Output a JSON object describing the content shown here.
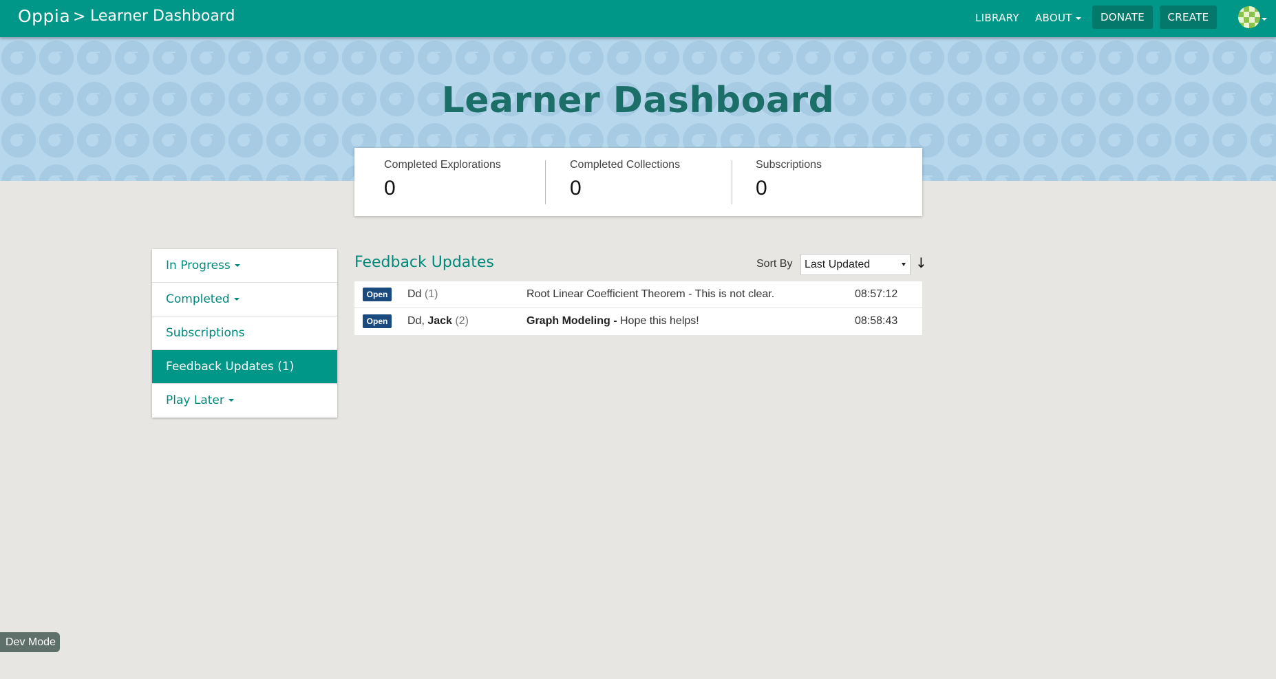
{
  "topbar": {
    "logo": "Oppia",
    "breadcrumb_sep": ">",
    "page_name": "Learner Dashboard",
    "links": {
      "library": "LIBRARY",
      "about": "ABOUT"
    },
    "buttons": {
      "donate": "DONATE",
      "create": "CREATE"
    }
  },
  "banner": {
    "title": "Learner Dashboard"
  },
  "stats": [
    {
      "label": "Completed Explorations",
      "value": "0"
    },
    {
      "label": "Completed Collections",
      "value": "0"
    },
    {
      "label": "Subscriptions",
      "value": "0"
    }
  ],
  "sidebar": {
    "items": [
      {
        "label": "In Progress",
        "has_caret": true
      },
      {
        "label": "Completed",
        "has_caret": true
      },
      {
        "label": "Subscriptions",
        "has_caret": false
      },
      {
        "label": "Feedback Updates (1)",
        "has_caret": false,
        "active": true
      },
      {
        "label": "Play Later",
        "has_caret": true
      }
    ]
  },
  "feedback": {
    "title": "Feedback Updates",
    "sort_label": "Sort By",
    "sort_value": "Last Updated",
    "sort_direction_icon": "↓",
    "rows": [
      {
        "status": "Open",
        "authors_plain": "Dd",
        "authors_bold": "",
        "count": "(1)",
        "subject_bold": "",
        "subject_text": "Root Linear Coefficient Theorem - This is not clear.",
        "time": "08:57:12"
      },
      {
        "status": "Open",
        "authors_plain": "Dd, ",
        "authors_bold": "Jack",
        "count": "(2)",
        "subject_bold": "Graph Modeling -",
        "subject_text": " Hope this helps!",
        "time": "08:58:43"
      }
    ]
  },
  "dev_mode": "Dev Mode",
  "colors": {
    "primary": "#009688",
    "primary_dark": "#05786c",
    "banner_bg": "#b6d7ec",
    "badge": "#1b4b7e",
    "page_bg": "#e8e6e2"
  }
}
